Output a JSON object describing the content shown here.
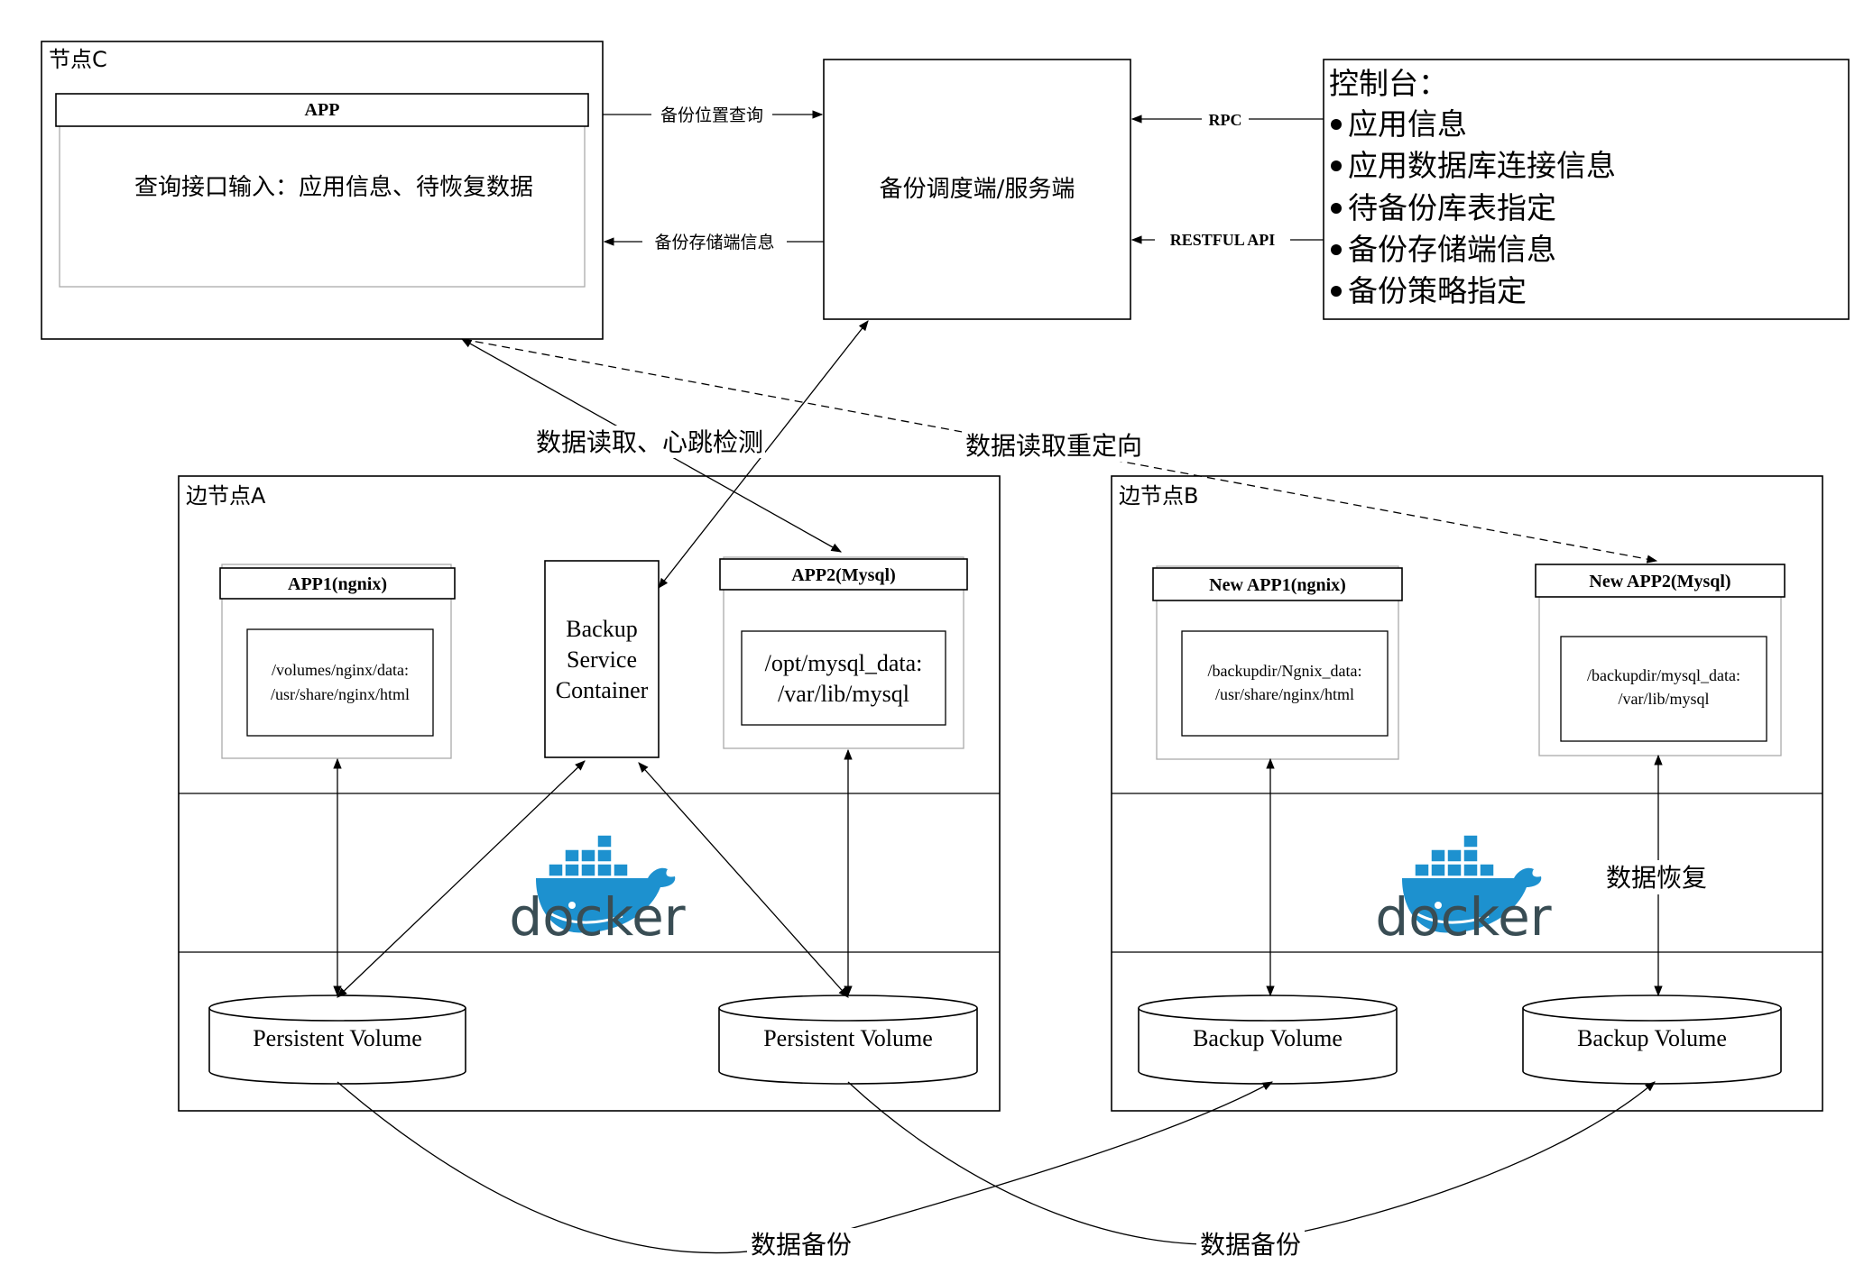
{
  "node_c": {
    "title": "节点C",
    "app_header": "APP",
    "app_body": "查询接口输入：应用信息、待恢复数据"
  },
  "scheduler": {
    "label": "备份调度端/服务端"
  },
  "console": {
    "title": "控制台：",
    "items": [
      "应用信息",
      "应用数据库连接信息",
      "待备份库表指定",
      "备份存储端信息",
      "备份策略指定"
    ]
  },
  "edges": {
    "backup_location_query": "备份位置查询",
    "backup_storage_info": "备份存储端信息",
    "rpc": "RPC",
    "restful": "RESTFUL API",
    "read_heartbeat": "数据读取、心跳检测",
    "read_redirect": "数据读取重定向",
    "data_backup_1": "数据备份",
    "data_backup_2": "数据备份",
    "data_restore": "数据恢复"
  },
  "edge_a": {
    "title": "边节点A",
    "app1_header": "APP1(ngnix)",
    "app1_mount_line1": "/volumes/nginx/data:",
    "app1_mount_line2": "/usr/share/nginx/html",
    "backup_container_line1": "Backup",
    "backup_container_line2": "Service",
    "backup_container_line3": "Container",
    "app2_header": "APP2(Mysql)",
    "app2_mount_line1": "/opt/mysql_data:",
    "app2_mount_line2": "/var/lib/mysql",
    "docker_logo_text": "docker",
    "volume_left": "Persistent Volume",
    "volume_right": "Persistent Volume"
  },
  "edge_b": {
    "title": "边节点B",
    "app1_header": "New APP1(ngnix)",
    "app1_mount_line1": "/backupdir/Ngnix_data:",
    "app1_mount_line2": "/usr/share/nginx/html",
    "app2_header": "New APP2(Mysql)",
    "app2_mount_line1": "/backupdir/mysql_data:",
    "app2_mount_line2": "/var/lib/mysql",
    "docker_logo_text": "docker",
    "volume_left": "Backup Volume",
    "volume_right": "Backup Volume"
  },
  "colors": {
    "docker_blue": "#1d91cf",
    "docker_dark": "#394d54",
    "ink": "#000000",
    "frame_grey": "#aaaaaa"
  }
}
